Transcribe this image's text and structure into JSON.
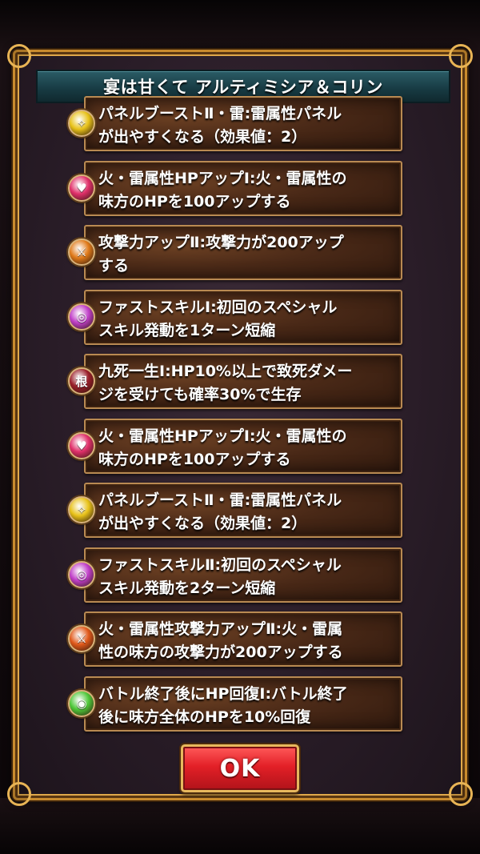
{
  "dialog": {
    "title": "宴は甘くて アルティミシア＆コリン",
    "ok_label": "OK"
  },
  "skills": [
    {
      "text": "パネルブーストⅡ・雷:雷属性パネル\nが出やすくなる（効果値：2）",
      "icon": "thunder-orb-icon",
      "icon_color": "#e8c21a",
      "glyph": "✧"
    },
    {
      "text": "火・雷属性HPアップⅠ:火・雷属性の\n味方のHPを100アップする",
      "icon": "heart-up-icon",
      "icon_color": "#e0306a",
      "glyph": "♥"
    },
    {
      "text": "攻撃力アップⅡ:攻撃力が200アップ\nする",
      "icon": "sword-up-icon",
      "icon_color": "#e07a1a",
      "glyph": "⚔"
    },
    {
      "text": "ファストスキルⅠ:初回のスペシャル\nスキル発動を1ターン短縮",
      "icon": "clock-orb-icon",
      "icon_color": "#c03fc8",
      "glyph": "◎"
    },
    {
      "text": "九死一生Ⅰ:HP10%以上で致死ダメー\nジを受けても確率30%で生存",
      "icon": "survive-icon",
      "icon_color": "#9a1f2a",
      "glyph": "根"
    },
    {
      "text": "火・雷属性HPアップⅠ:火・雷属性の\n味方のHPを100アップする",
      "icon": "heart-up-icon",
      "icon_color": "#e0306a",
      "glyph": "♥"
    },
    {
      "text": "パネルブーストⅡ・雷:雷属性パネル\nが出やすくなる（効果値：2）",
      "icon": "thunder-orb-icon",
      "icon_color": "#e8c21a",
      "glyph": "✧"
    },
    {
      "text": "ファストスキルⅡ:初回のスペシャル\nスキル発動を2ターン短縮",
      "icon": "clock-orb-icon",
      "icon_color": "#c03fc8",
      "glyph": "◎"
    },
    {
      "text": "火・雷属性攻撃力アップⅡ:火・雷属\n性の味方の攻撃力が200アップする",
      "icon": "sword-up-icon",
      "icon_color": "#e0581a",
      "glyph": "⚔"
    },
    {
      "text": "バトル終了後にHP回復Ⅰ:バトル終了\n後に味方全体のHPを10%回復",
      "icon": "heal-orb-icon",
      "icon_color": "#4fc83a",
      "glyph": "◉"
    }
  ]
}
